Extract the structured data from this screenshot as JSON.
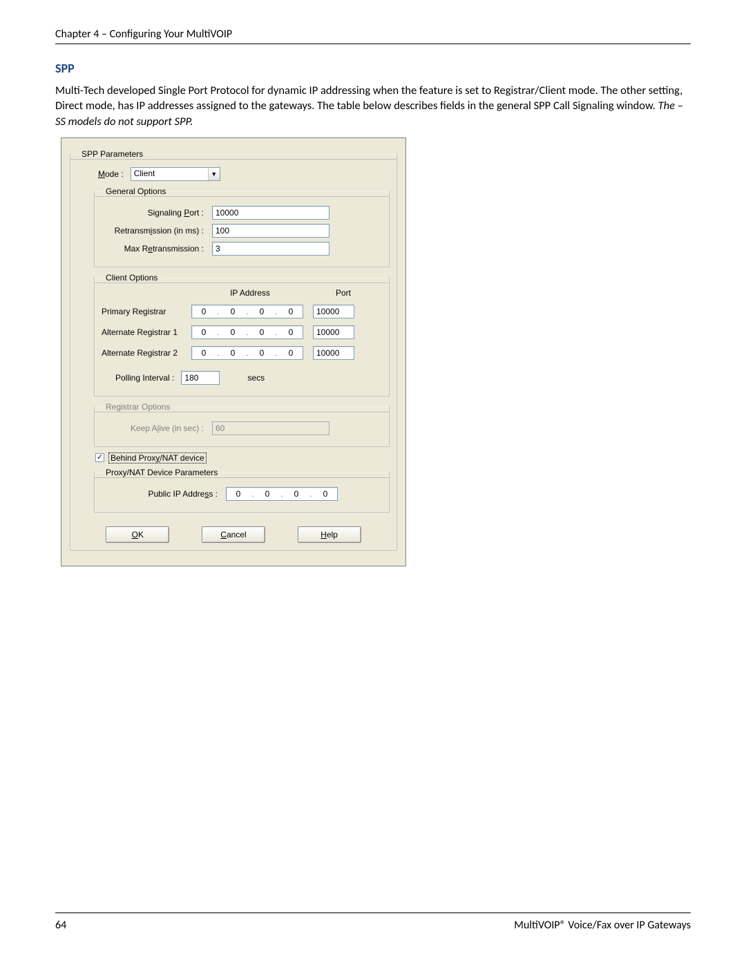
{
  "header": {
    "chapter": "Chapter 4 – Configuring Your MultiVOIP"
  },
  "section": {
    "title": "SPP",
    "paragraph_a": "Multi-Tech developed Single Port Protocol for dynamic IP addressing when the feature is set to Registrar/Client mode. The other setting, Direct mode, has IP addresses assigned to the gateways. The table below describes fields in the general SPP Call Signaling window. ",
    "paragraph_em": "The –SS models do not support SPP."
  },
  "dialog": {
    "group_title": "SPP Parameters",
    "mode_label_pre": "M",
    "mode_label_post": "ode :",
    "mode_value": "Client",
    "general": {
      "legend": "General Options",
      "signaling_port_label_pre": "Signaling ",
      "signaling_port_u": "P",
      "signaling_port_label_post": "ort :",
      "signaling_port_value": "10000",
      "retrans_label_pre": "Retransm",
      "retrans_u": "i",
      "retrans_label_post": "ssion (in ms) :",
      "retrans_value": "100",
      "maxretrans_label_pre": "Max R",
      "maxretrans_u": "e",
      "maxretrans_label_post": "transmission :",
      "maxretrans_value": "3"
    },
    "client": {
      "legend": "Client Options",
      "ip_header": "IP Address",
      "port_header": "Port",
      "rows": [
        {
          "label": "Primary Registrar",
          "o1": "0",
          "o2": "0",
          "o3": "0",
          "o4": "0",
          "port": "10000"
        },
        {
          "label": "Alternate Registrar 1",
          "o1": "0",
          "o2": "0",
          "o3": "0",
          "o4": "0",
          "port": "10000"
        },
        {
          "label": "Alternate Registrar 2",
          "o1": "0",
          "o2": "0",
          "o3": "0",
          "o4": "0",
          "port": "10000"
        }
      ],
      "polling_label": "Polling Interval :",
      "polling_value": "180",
      "polling_unit": "secs"
    },
    "registrar": {
      "legend": "Registrar Options",
      "keepalive_label_pre": "Keep A",
      "keepalive_u": "l",
      "keepalive_label_post": "ive (in sec) :",
      "keepalive_value": "60"
    },
    "nat": {
      "check_pre": "Behind Prox",
      "check_u": "y",
      "check_post": "/NAT device",
      "legend": "Proxy/NAT Device Parameters",
      "public_ip_label_pre": "Public IP Addre",
      "public_ip_u": "s",
      "public_ip_label_post": "s :",
      "ip": {
        "o1": "0",
        "o2": "0",
        "o3": "0",
        "o4": "0"
      }
    },
    "buttons": {
      "ok_u": "O",
      "ok_post": "K",
      "cancel_u": "C",
      "cancel_post": "ancel",
      "help_u": "H",
      "help_post": "elp"
    }
  },
  "footer": {
    "page": "64",
    "book": "MultiVOIP® Voice/Fax over IP Gateways"
  }
}
